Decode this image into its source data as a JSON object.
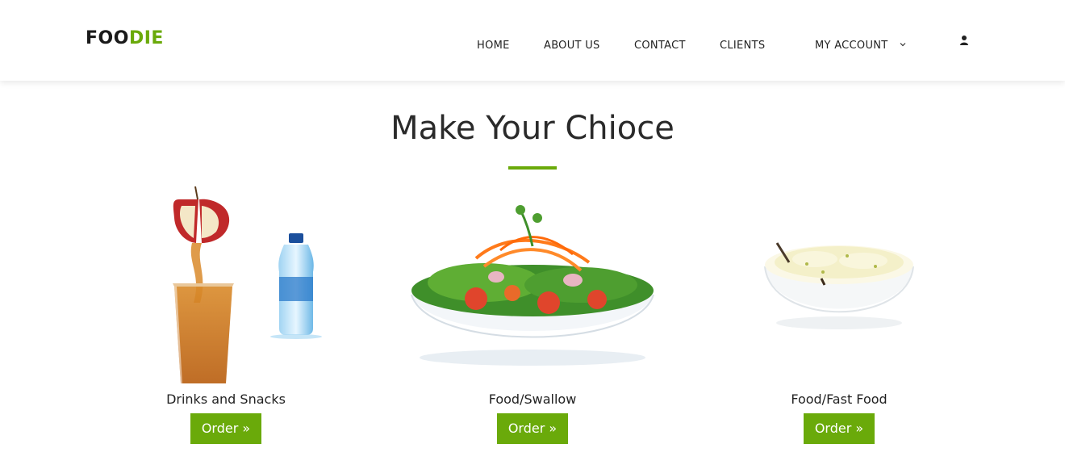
{
  "brand": {
    "part1": "FOO",
    "part2": "DIE"
  },
  "nav": {
    "home": "HOME",
    "about": "ABOUT US",
    "contact": "CONTACT",
    "clients": "CLIENTS",
    "account": "MY ACCOUNT"
  },
  "icons": {
    "account_chevron": "chevron-down-icon",
    "user": "user-icon"
  },
  "main": {
    "title": "Make Your Chioce",
    "cards": [
      {
        "label": "Drinks and Snacks",
        "button": "Order »",
        "image": "apple-juice-and-water-bottle"
      },
      {
        "label": "Food/Swallow",
        "button": "Order »",
        "image": "salad-bowl"
      },
      {
        "label": "Food/Fast Food",
        "button": "Order »",
        "image": "rice-bowl"
      }
    ]
  },
  "colors": {
    "accent": "#6aaa0a",
    "text": "#222222",
    "background": "#ffffff"
  }
}
